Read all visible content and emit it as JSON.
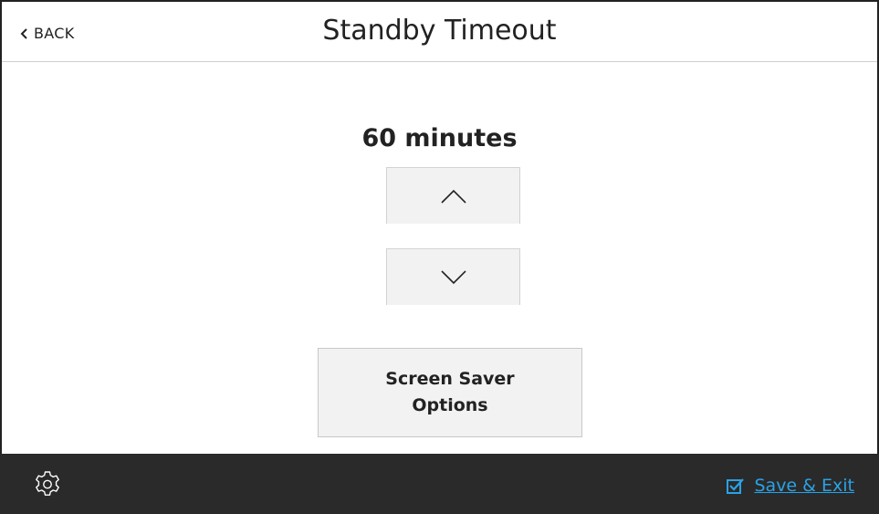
{
  "header": {
    "back_label": "BACK",
    "title": "Standby Timeout"
  },
  "timeout": {
    "value_text": "60 minutes"
  },
  "screen_saver_button": {
    "label": "Screen Saver\nOptions"
  },
  "footer": {
    "save_label": "Save & Exit"
  },
  "colors": {
    "footer_bg": "#2a2a2a",
    "accent": "#2aa2e6",
    "button_bg": "#f2f2f2"
  },
  "icons": {
    "back": "chevron-left-icon",
    "up": "chevron-up-icon",
    "down": "chevron-down-icon",
    "settings": "gear-icon",
    "save": "checkbox-checked-icon"
  }
}
